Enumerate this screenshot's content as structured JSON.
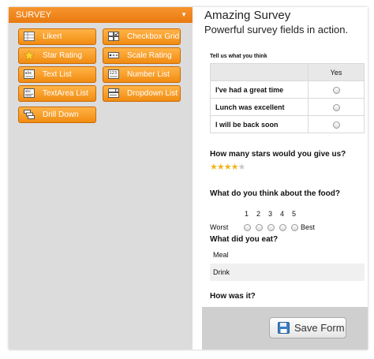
{
  "sidebar": {
    "header": "SURVEY",
    "tools": [
      {
        "label": "Likert",
        "icon": "likert-icon"
      },
      {
        "label": "Checkbox Grid",
        "icon": "checkbox-grid-icon"
      },
      {
        "label": "Star Rating",
        "icon": "star-icon"
      },
      {
        "label": "Scale Rating",
        "icon": "scale-rating-icon"
      },
      {
        "label": "Text List",
        "icon": "text-list-icon"
      },
      {
        "label": "Number List",
        "icon": "number-list-icon"
      },
      {
        "label": "TextArea List",
        "icon": "textarea-list-icon"
      },
      {
        "label": "Dropdown List",
        "icon": "dropdown-list-icon"
      },
      {
        "label": "Drill Down",
        "icon": "drill-down-icon"
      }
    ]
  },
  "form": {
    "title": "Amazing Survey",
    "subtitle": "Powerful survey fields in action.",
    "likert": {
      "question": "Tell us what you think",
      "column": "Yes",
      "rows": [
        "I've had a great time",
        "Lunch was excellent",
        "I will be back soon"
      ]
    },
    "stars": {
      "question": "How many stars would you give us?",
      "rating": 4,
      "max": 5
    },
    "scale": {
      "question": "What do you think about the food?",
      "numbers": [
        "1",
        "2",
        "3",
        "4",
        "5"
      ],
      "low_label": "Worst",
      "high_label": "Best"
    },
    "eat": {
      "question": "What did you eat?",
      "options": [
        "Meal",
        "Drink"
      ]
    },
    "how": {
      "question": "How was it?"
    },
    "save_label": "Save Form"
  },
  "colors": {
    "accent": "#f18c11",
    "panel_bg": "#dcdcdc",
    "footer_bg": "#cfcfcf",
    "star": "#f0b41c"
  }
}
